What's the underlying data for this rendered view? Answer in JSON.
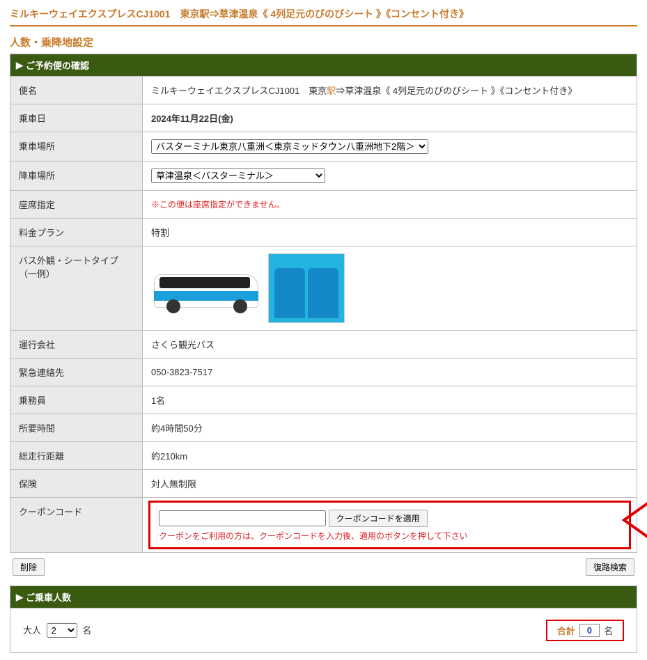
{
  "page_title": "ミルキーウェイエクスプレスCJ1001　東京駅⇒草津温泉《 4列足元のびのびシート 》《コンセント付き》",
  "section_heading": "人数・乗降地設定",
  "panel1_header": "ご予約便の確認",
  "labels": {
    "route_name": "便名",
    "ride_date": "乗車日",
    "boarding": "乗車場所",
    "alighting": "降車場所",
    "seat_spec": "座席指定",
    "fare_plan": "料金プラン",
    "bus_appearance": "バス外観・シートタイプ（一例）",
    "operator": "運行会社",
    "emergency": "緊急連絡先",
    "crew": "乗務員",
    "duration": "所要時間",
    "distance": "総走行距離",
    "insurance": "保険",
    "coupon": "クーポンコード"
  },
  "values": {
    "route_name_prefix": "ミルキーウェイエクスプレスCJ1001　東京",
    "route_name_link": "駅",
    "route_name_suffix": "⇒草津温泉《 4列足元のびのびシート 》《コンセント付き》",
    "ride_date": "2024年11月22日(金)",
    "boarding_option": "バスターミナル東京八重洲＜東京ミッドタウン八重洲地下2階＞",
    "alighting_option": "草津温泉＜バスターミナル＞",
    "seat_note": "※この便は座席指定ができません。",
    "fare_plan": "特割",
    "operator": "さくら観光バス",
    "emergency": "050-3823-7517",
    "crew": "1名",
    "duration": "約4時間50分",
    "distance": "約210km",
    "insurance": "対人無制限",
    "coupon_button": "クーポンコードを適用",
    "coupon_hint": "クーポンをご利用の方は、クーポンコードを入力後、適用のボタンを押して下さい"
  },
  "buttons": {
    "delete": "削除",
    "return_search": "復路検索"
  },
  "panel2_header": "ご乗車人数",
  "passengers": {
    "adult_label": "大人",
    "adult_count": "2",
    "unit": "名",
    "total_label": "合計",
    "total_value": "0"
  }
}
